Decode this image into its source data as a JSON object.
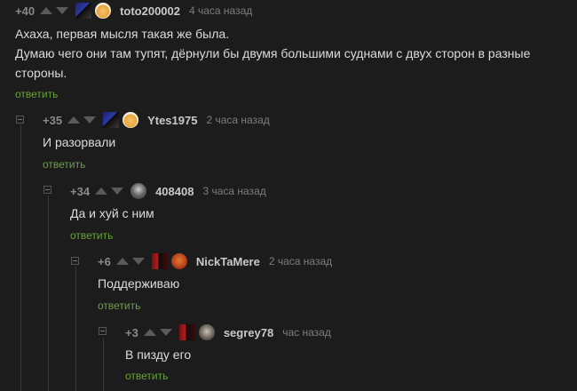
{
  "comments": [
    {
      "rating": "+40",
      "username": "toto200002",
      "time": "4 часа назад",
      "lines": [
        "Ахаха, первая мысля такая же была.",
        "Думаю чего они там тупят, дёрнули бы двумя большими суднами с двух сторон в разные",
        "стороны."
      ],
      "reply": "ответить"
    },
    {
      "rating": "+35",
      "username": "Ytes1975",
      "time": "2 часа назад",
      "lines": [
        "И разорвали"
      ],
      "reply": "ответить"
    },
    {
      "rating": "+34",
      "username": "408408",
      "time": "3 часа назад",
      "lines": [
        "Да и хуй с ним"
      ],
      "reply": "ответить"
    },
    {
      "rating": "+6",
      "username": "NickTaMere",
      "time": "2 часа назад",
      "lines": [
        "Поддерживаю"
      ],
      "reply": "ответить"
    },
    {
      "rating": "+3",
      "username": "segrey78",
      "time": "час назад",
      "lines": [
        "В пизду его"
      ],
      "reply": "ответить"
    }
  ],
  "colors": {
    "background": "#1c1c1c",
    "reply_link": "#6aa13f",
    "text": "#dcdcdc"
  }
}
